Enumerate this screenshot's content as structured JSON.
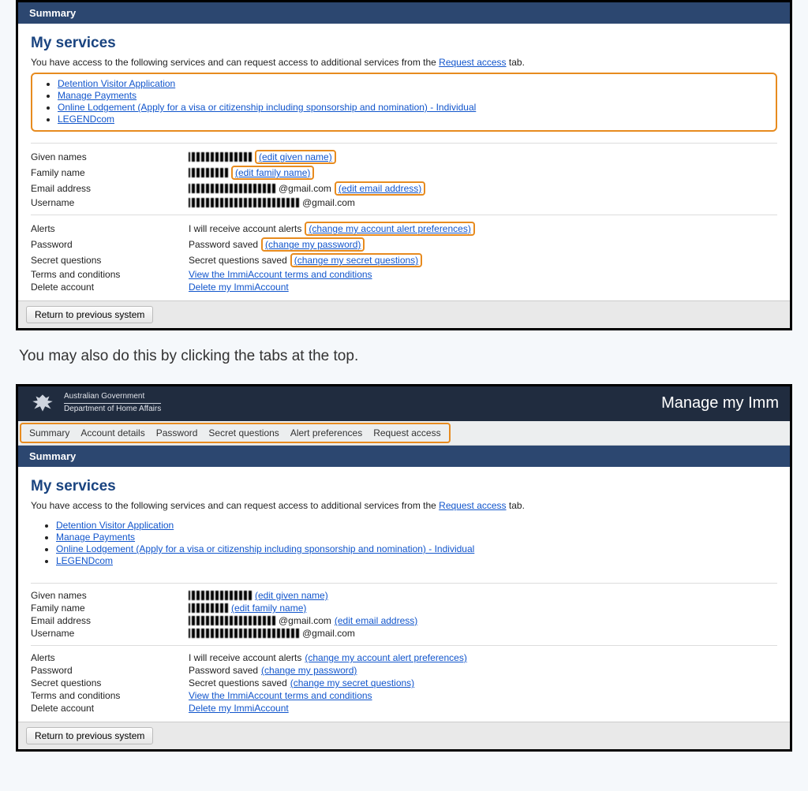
{
  "summaryHeader": "Summary",
  "myServicesHeading": "My services",
  "introPrefix": "You have access to the following services and can request access to additional services from the ",
  "requestAccessLink": "Request access",
  "introSuffix": " tab.",
  "services": [
    "Detention Visitor Application",
    "Manage Payments",
    "Online Lodgement (Apply for a visa or citizenship including sponsorship and nomination) - Individual",
    "LEGENDcom"
  ],
  "profile": {
    "givenNamesLabel": "Given names",
    "givenNamesEdit": "(edit given name)",
    "familyNameLabel": "Family name",
    "familyNameEdit": "(edit family name)",
    "emailLabel": "Email address",
    "emailSuffix": "@gmail.com",
    "emailEdit": "(edit email address)",
    "usernameLabel": "Username",
    "usernameSuffix": "@gmail.com"
  },
  "account": {
    "alertsLabel": "Alerts",
    "alertsText": "I will receive account alerts ",
    "alertsLink": "(change my account alert preferences)",
    "passwordLabel": "Password",
    "passwordText": "Password saved ",
    "passwordLink": "(change my password)",
    "secretLabel": "Secret questions",
    "secretText": "Secret questions saved ",
    "secretLink": "(change my secret questions)",
    "termsLabel": "Terms and conditions",
    "termsLink": "View the ImmiAccount terms and conditions",
    "deleteLabel": "Delete account",
    "deleteLink": "Delete my ImmiAccount"
  },
  "returnButton": "Return to previous system",
  "caption": "You may also do this by clicking the tabs at the top.",
  "gov": {
    "line1": "Australian Government",
    "line2": "Department of Home Affairs"
  },
  "manageTitle": "Manage my Imm",
  "tabs": [
    "Summary",
    "Account details",
    "Password",
    "Secret questions",
    "Alert preferences",
    "Request access"
  ]
}
